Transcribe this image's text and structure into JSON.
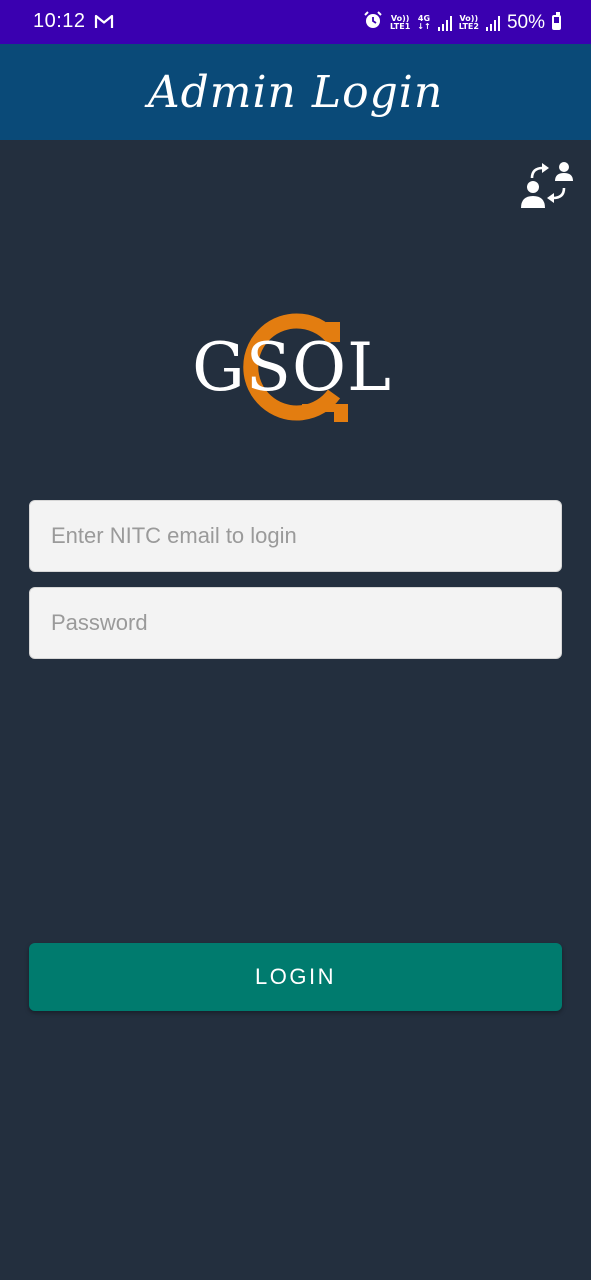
{
  "status_bar": {
    "time": "10:12",
    "net1_top": "Vo))",
    "net1_bottom": "LTE1",
    "net_type_top": "4G",
    "net_type_bottom": "↓↑",
    "net2_top": "Vo))",
    "net2_bottom": "LTE2",
    "battery": "50%",
    "battery_level": 0.5
  },
  "header": {
    "title": "Admin Login",
    "background": "#0a4a78"
  },
  "switch_role": {
    "icon": "switch-user-icon"
  },
  "logo": {
    "text": "GSOL",
    "accent": "#e37d10"
  },
  "form": {
    "email": {
      "value": "",
      "placeholder": "Enter NITC email to login"
    },
    "password": {
      "value": "",
      "placeholder": "Password"
    },
    "login_label": "LOGIN"
  },
  "colors": {
    "status_bar": "#3a00b0",
    "page_background": "#232f3e",
    "button": "#007b6e"
  }
}
